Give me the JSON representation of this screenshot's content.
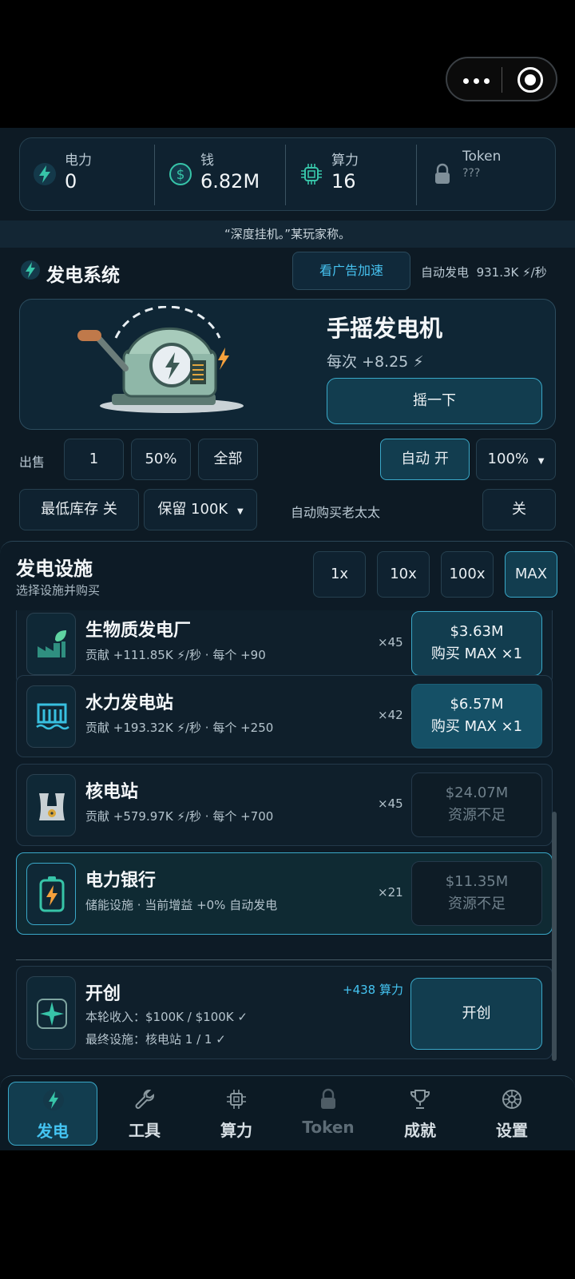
{
  "resources": [
    {
      "label": "电力",
      "value": "0",
      "icon": "bolt-icon"
    },
    {
      "label": "钱",
      "value": "6.82M",
      "icon": "dollar-icon"
    },
    {
      "label": "算力",
      "value": "16",
      "icon": "chip-icon"
    },
    {
      "label": "Token",
      "value": "???",
      "icon": "lock-icon"
    }
  ],
  "quote": "“深度挂机。”某玩家称。",
  "gen_system": {
    "title": "发电系统",
    "ad_button": "看广告加速",
    "auto_gen_label": "自动发电",
    "auto_gen_value": "931.3K ⚡/秒"
  },
  "generator": {
    "name": "手摇发电机",
    "per_crank": "每次 +8.25 ⚡",
    "crank_button": "摇一下"
  },
  "sell": {
    "label": "出售",
    "options": [
      "1",
      "50%",
      "全部"
    ],
    "auto_button": "自动  开",
    "percent_select": "100%"
  },
  "stock": {
    "min_stock_button": "最低库存  关",
    "reserve_select": "保留 100K",
    "auto_buy_label": "自动购买老太太",
    "auto_buy_toggle": "关"
  },
  "facilities": {
    "title": "发电设施",
    "subtitle": "选择设施并购买",
    "multipliers": [
      "1x",
      "10x",
      "100x",
      "MAX"
    ],
    "selected_multiplier": "MAX",
    "items": [
      {
        "name": "生物质发电厂",
        "desc": "贡献 +111.85K ⚡/秒 · 每个 +90",
        "count": "×45",
        "price": "$3.63M",
        "action": "购买 MAX ×1",
        "state": "ok",
        "icon": "biomass-plant-icon"
      },
      {
        "name": "水力发电站",
        "desc": "贡献 +193.32K ⚡/秒 · 每个 +250",
        "count": "×42",
        "price": "$6.57M",
        "action": "购买 MAX ×1",
        "state": "ok",
        "icon": "hydro-dam-icon"
      },
      {
        "name": "核电站",
        "desc": "贡献 +579.97K ⚡/秒 · 每个 +700",
        "count": "×45",
        "price": "$24.07M",
        "action": "资源不足",
        "state": "insufficient",
        "icon": "nuclear-plant-icon"
      },
      {
        "name": "电力银行",
        "desc": "储能设施 · 当前增益 +0% 自动发电",
        "count": "×21",
        "price": "$11.35M",
        "action": "资源不足",
        "state": "insufficient",
        "icon": "battery-icon"
      }
    ],
    "pioneer": {
      "name": "开创",
      "reward": "+438 算力",
      "line1": "本轮收入：$100K / $100K ✓",
      "line2": "最终设施：核电站 1 / 1 ✓",
      "button": "开创"
    }
  },
  "tabs": [
    {
      "label": "发电",
      "icon": "bolt-icon",
      "active": true
    },
    {
      "label": "工具",
      "icon": "wrench-icon"
    },
    {
      "label": "算力",
      "icon": "chip-icon"
    },
    {
      "label": "Token",
      "icon": "lock-icon",
      "disabled": true
    },
    {
      "label": "成就",
      "icon": "trophy-icon"
    },
    {
      "label": "设置",
      "icon": "gear-icon"
    }
  ],
  "colors": {
    "accent": "#44c4f2",
    "background": "#0d1a24",
    "lightning": "#f6b73c"
  }
}
